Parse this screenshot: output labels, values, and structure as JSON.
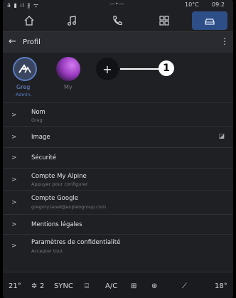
{
  "statusbar": {
    "left": "ä ▮ ıl ∦ ᯤ",
    "center": "—•—",
    "temperature": "10°C",
    "time": "09:2"
  },
  "nav": {
    "items": [
      "home-icon",
      "music-icon",
      "phone-icon",
      "apps-icon",
      "car-icon"
    ],
    "active": "car-icon"
  },
  "header": {
    "title": "Profil"
  },
  "profiles": {
    "items": [
      {
        "name": "Greg",
        "role": "Admin."
      },
      {
        "name": "My"
      }
    ],
    "add_label": "+"
  },
  "callout": {
    "number": "1"
  },
  "menu": {
    "items": [
      {
        "label": "Nom",
        "sub": "Greg"
      },
      {
        "label": "Image",
        "icon": "image-icon"
      },
      {
        "label": "Sécurité"
      },
      {
        "label": "Compte My Alpine",
        "sub": "Appuyer pour configurer"
      },
      {
        "label": "Compte Google",
        "sub": "gregory.lanel@expleogroup.com"
      },
      {
        "label": "Mentions légales"
      },
      {
        "label": "Paramètres de confidentialité",
        "sub": "Accepter tout"
      }
    ]
  },
  "climate": {
    "temp_left": "21°",
    "fan": "2",
    "sync": "SYNC",
    "ac": "A/C",
    "temp_right": "18°"
  }
}
